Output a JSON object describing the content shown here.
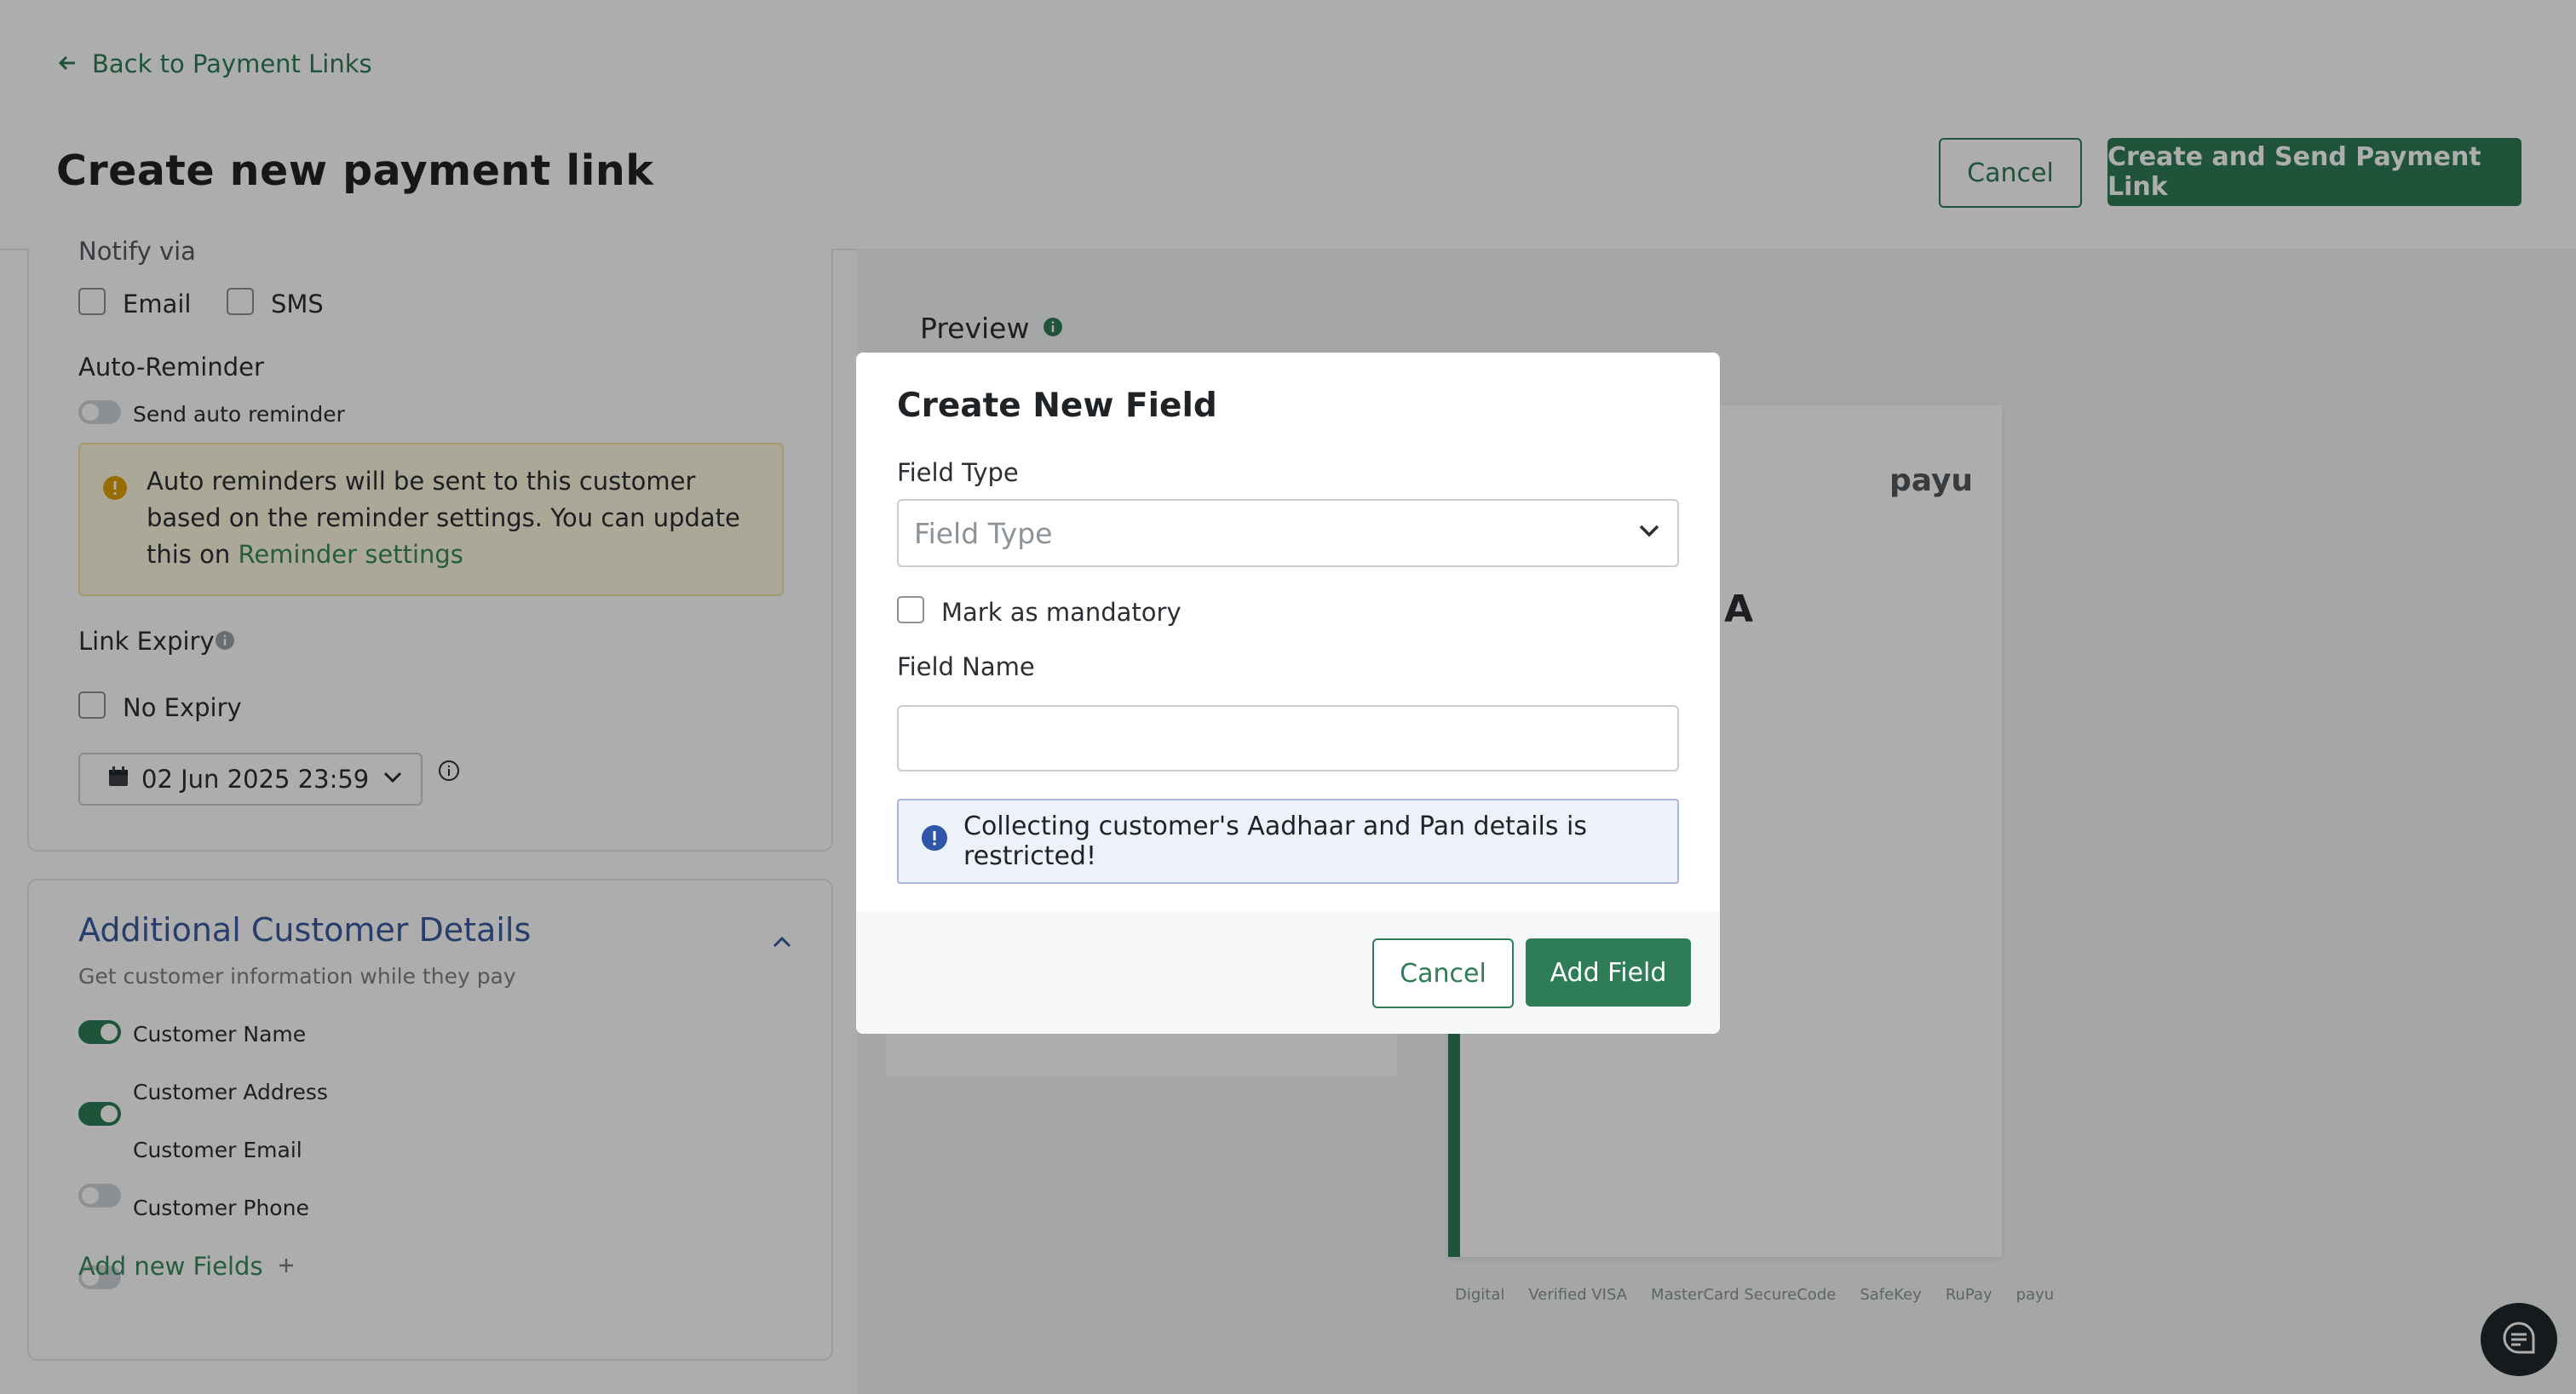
{
  "header": {
    "back_label": "Back to Payment Links",
    "title": "Create new payment link",
    "cancel_label": "Cancel",
    "create_send_label": "Create and Send Payment Link"
  },
  "left_panel": {
    "notify_heading": "Notify via",
    "notify_email": "Email",
    "notify_sms": "SMS",
    "auto_reminder_heading": "Auto-Reminder",
    "send_auto_reminder": "Send auto reminder",
    "reminder_text": "Auto reminders will be sent to this customer based on the reminder settings. You can update this on",
    "reminder_link": "Reminder settings",
    "link_expiry_heading": "Link Expiry",
    "no_expiry": "No Expiry",
    "expiry_date": "02 Jun 2025 23:59"
  },
  "additional_details": {
    "title": "Additional Customer Details",
    "subtitle": "Get customer information while they pay",
    "fields": [
      {
        "label": "Customer Name",
        "enabled": true
      },
      {
        "label": "Customer Address",
        "enabled": true
      },
      {
        "label": "Customer Email",
        "enabled": false
      },
      {
        "label": "Customer Phone",
        "enabled": false
      }
    ],
    "add_fields_label": "Add new Fields"
  },
  "preview": {
    "heading": "Preview",
    "merchant_initial": "A",
    "brand_logo": "payu",
    "badges": [
      "Digital",
      "Verified VISA",
      "MasterCard SecureCode",
      "SafeKey",
      "RuPay",
      "payu"
    ]
  },
  "modal": {
    "title": "Create New Field",
    "field_type_label": "Field Type",
    "field_type_placeholder": "Field Type",
    "mandatory_label": "Mark as mandatory",
    "field_name_label": "Field Name",
    "field_name_value": "",
    "info_text": "Collecting customer's Aadhaar and Pan details is restricted!",
    "cancel_label": "Cancel",
    "add_label": "Add Field"
  },
  "colors": {
    "accent": "#2e7d57",
    "link_blue": "#3a5ba0",
    "overlay": "rgba(0,0,0,0.32)"
  }
}
